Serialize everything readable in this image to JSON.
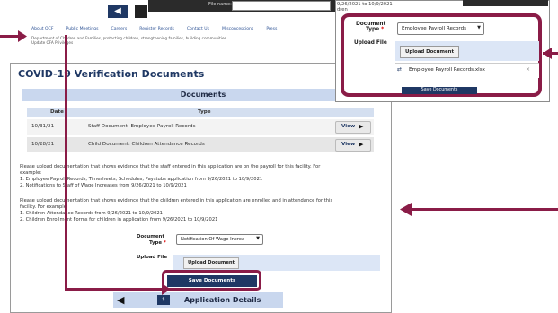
{
  "background_header": {
    "prev_icon": "left-triangle-icon",
    "file_dialog": {
      "label": "File name:",
      "value": ""
    },
    "footer_links": [
      "About OCF",
      "Public Meetings",
      "Careers",
      "Register Records",
      "Contact Us",
      "Misconceptions",
      "Press"
    ],
    "footer_tagline": "Department of Children and Families, protecting children, strengthening families, building communities",
    "footer_policy": "Update OFA Privileges"
  },
  "main": {
    "title": "COVID-19 Verification Documents",
    "documents_header": "Documents",
    "table": {
      "columns": [
        "Date",
        "Type"
      ],
      "rows": [
        {
          "date": "10/31/21",
          "type": "Staff Document: Employee Payroll Records",
          "action": "View"
        },
        {
          "date": "10/28/21",
          "type": "Child Document: Children Attendance Records",
          "action": "View"
        }
      ]
    },
    "instructions_staff": [
      "Please upload documentation that shows evidence that the staff entered in this application are on the payroll for this facility. For",
      "example:",
      "1. Employee Payroll Records, Timesheets, Schedules, Paystubs application from 9/26/2021 to 10/9/2021",
      "2. Notifications to Staff of Wage Increases from 9/26/2021 to 10/9/2021"
    ],
    "instructions_children": [
      "Please upload documentation that shows evidence that the children entered in this application are enrolled and in attendance for this",
      "facility. For example:",
      "1. Children Attendance Records from 9/26/2021 to 10/9/2021",
      "2. Children Enrollment Forms for children in application from 9/26/2021 to 10/9/2021"
    ],
    "form": {
      "document_type_label": "Document",
      "document_type_label2": "Type",
      "required_mark": "*",
      "document_type_value": "Notification Of Wage Increa",
      "upload_file_label": "Upload File",
      "upload_button": "Upload Document",
      "save_button": "Save Documents"
    },
    "application_bar": {
      "prev_icon": "left-triangle-icon",
      "icon": "money-icon",
      "icon_text": "$",
      "label": "Application Details"
    }
  },
  "callout": {
    "dates": [
      "9/26/2021 to 10/9/2021",
      "dren"
    ],
    "document_type_label": "Document",
    "document_type_label2": "Type",
    "required_mark": "*",
    "document_type_value": "Employee Payroll Records",
    "upload_file_label": "Upload File",
    "upload_button": "Upload Document",
    "file_icon": "attachment-icon",
    "file_name": "Employee Payroll Records.xlsx",
    "remove_icon": "close-icon",
    "submit_button": "Save Documents"
  },
  "colors": {
    "highlight": "#8a1c47",
    "navy": "#1f3864",
    "header_blue": "#c9d7ee"
  }
}
